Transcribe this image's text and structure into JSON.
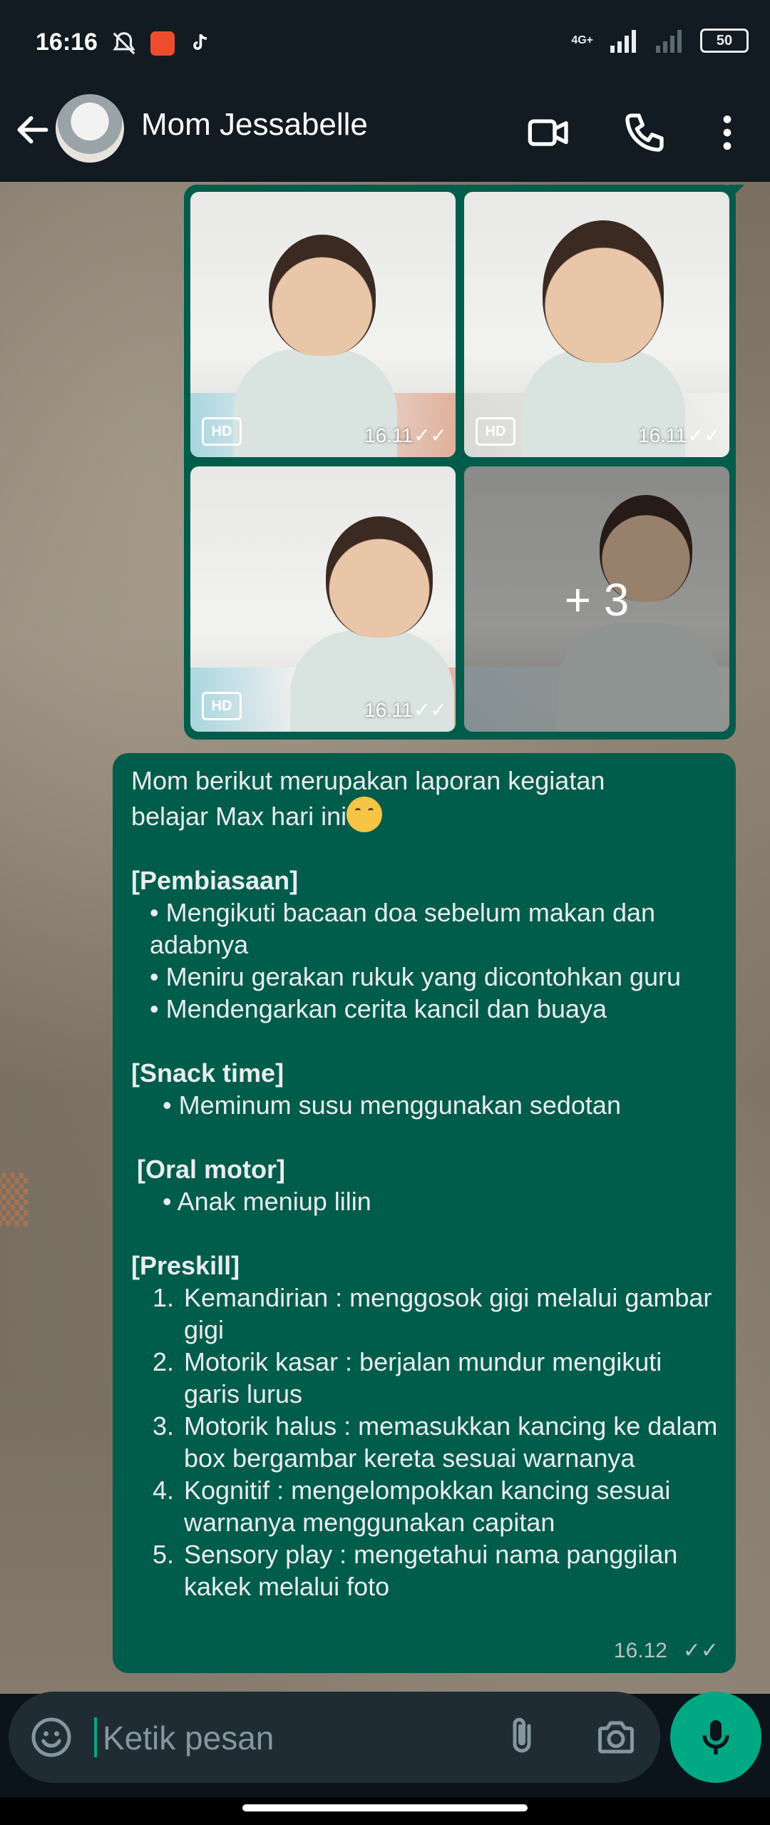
{
  "status_bar": {
    "time": "16:16",
    "network": "4G+",
    "battery": "50"
  },
  "header": {
    "contact_name": "Mom Jessabelle",
    "icons": [
      "back-arrow-icon",
      "video-call-icon",
      "voice-call-icon",
      "more-options-icon"
    ]
  },
  "album": {
    "photos": [
      {
        "badge": "HD",
        "time": "16.11",
        "ticks": "✓✓"
      },
      {
        "badge": "HD",
        "time": "16.11",
        "ticks": "✓✓"
      },
      {
        "badge": "HD",
        "time": "16.11",
        "ticks": "✓✓"
      },
      {
        "more": "+ 3"
      }
    ]
  },
  "message": {
    "intro_1": "Mom berikut merupakan laporan kegiatan",
    "intro_2": "belajar Max hari ini",
    "sec1_title": "[Pembiasaan]",
    "sec1_items": [
      "• Mengikuti bacaan doa sebelum makan dan adabnya",
      "• Meniru gerakan rukuk yang dicontohkan guru",
      "• Mendengarkan cerita kancil dan buaya"
    ],
    "sec2_title": "[Snack time]",
    "sec2_items": [
      "•  Meminum susu menggunakan sedotan"
    ],
    "sec3_title": "[Oral motor]",
    "sec3_items": [
      "•  Anak meniup lilin"
    ],
    "sec4_title": "[Preskill]",
    "sec4_items": [
      {
        "n": "1.",
        "text": "Kemandirian : menggosok gigi melalui gambar gigi"
      },
      {
        "n": "2.",
        "text": "Motorik kasar : berjalan mundur mengikuti garis lurus"
      },
      {
        "n": "3.",
        "text": "Motorik halus : memasukkan kancing ke dalam box bergambar kereta sesuai warnanya"
      },
      {
        "n": "4.",
        "text": "Kognitif : mengelompokkan kancing sesuai warnanya menggunakan capitan"
      },
      {
        "n": "5.",
        "text": "Sensory play : mengetahui nama panggilan kakek melalui foto"
      }
    ],
    "time": "16.12",
    "ticks": "✓✓"
  },
  "input": {
    "placeholder": "Ketik pesan"
  },
  "colors": {
    "bubble": "#005c4b",
    "accent": "#00a884",
    "header": "#111b21"
  }
}
